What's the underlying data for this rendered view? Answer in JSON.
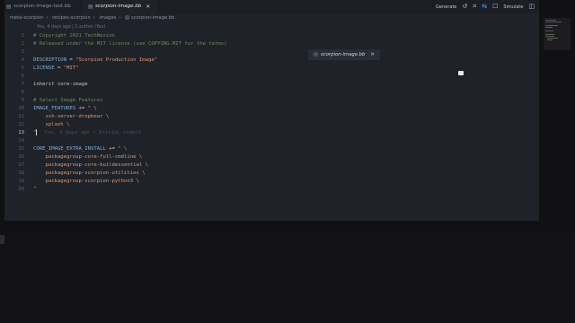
{
  "tabs": [
    {
      "label": "scorpion-image-test.bb",
      "active": false
    },
    {
      "label": "scorpion-image.bb",
      "active": true
    }
  ],
  "breadcrumb": [
    "meta-scorpion",
    "recipes-scorpion",
    "images",
    "scorpion-image.bb"
  ],
  "blame_header": "You, 4 days ago | 1 author (You)",
  "toolbar": {
    "generate": "Generate",
    "simulate": "Simulate"
  },
  "floating_tab": {
    "label": "scorpion-image.bb"
  },
  "current_line": 13,
  "inline_blame": "You, 4 days ago • Initial commit",
  "lines": [
    {
      "n": "1",
      "parts": [
        {
          "t": "# Copyright 2021 TechNexion",
          "c": "c-comment"
        }
      ]
    },
    {
      "n": "2",
      "parts": [
        {
          "t": "# Released under the MIT license (see COPYING.MIT for the terms)",
          "c": "c-comment"
        }
      ]
    },
    {
      "n": "3",
      "parts": []
    },
    {
      "n": "4",
      "parts": [
        {
          "t": "DESCRIPTION",
          "c": "c-var"
        },
        {
          "t": " = ",
          "c": "c-op"
        },
        {
          "t": "\"Scorpion Production Image\"",
          "c": "c-str"
        }
      ]
    },
    {
      "n": "5",
      "parts": [
        {
          "t": "LICENSE",
          "c": "c-var"
        },
        {
          "t": " = ",
          "c": "c-op"
        },
        {
          "t": "\"MIT\"",
          "c": "c-str"
        }
      ]
    },
    {
      "n": "6",
      "parts": []
    },
    {
      "n": "7",
      "parts": [
        {
          "t": "inherit core-image",
          "c": "c-plain"
        }
      ]
    },
    {
      "n": "8",
      "parts": []
    },
    {
      "n": "9",
      "parts": [
        {
          "t": "# Select Image Features",
          "c": "c-comment"
        }
      ]
    },
    {
      "n": "10",
      "parts": [
        {
          "t": "IMAGE_FEATURES",
          "c": "c-var"
        },
        {
          "t": " += ",
          "c": "c-op"
        },
        {
          "t": "\" \\",
          "c": "c-str"
        }
      ]
    },
    {
      "n": "11",
      "parts": [
        {
          "t": "    ssh-server-dropbear \\",
          "c": "c-str"
        }
      ]
    },
    {
      "n": "12",
      "parts": [
        {
          "t": "    splash \\",
          "c": "c-str"
        }
      ]
    },
    {
      "n": "13",
      "parts": [
        {
          "t": "\"",
          "c": "c-str"
        }
      ]
    },
    {
      "n": "14",
      "parts": []
    },
    {
      "n": "15",
      "parts": [
        {
          "t": "CORE_IMAGE_EXTRA_INSTALL",
          "c": "c-var"
        },
        {
          "t": " += ",
          "c": "c-op"
        },
        {
          "t": "\" \\",
          "c": "c-str"
        }
      ]
    },
    {
      "n": "16",
      "parts": [
        {
          "t": "    packagegroup-core-full-cmdline \\",
          "c": "c-str"
        }
      ]
    },
    {
      "n": "17",
      "parts": [
        {
          "t": "    packagegroup-core-buildessential \\",
          "c": "c-str"
        }
      ]
    },
    {
      "n": "18",
      "parts": [
        {
          "t": "    packagegroup-scorpion-utilities \\",
          "c": "c-str"
        }
      ]
    },
    {
      "n": "19",
      "parts": [
        {
          "t": "    packagegroup-scorpion-python3 \\",
          "c": "c-str"
        }
      ]
    },
    {
      "n": "20",
      "parts": [
        {
          "t": "\"",
          "c": "c-str"
        }
      ]
    }
  ]
}
